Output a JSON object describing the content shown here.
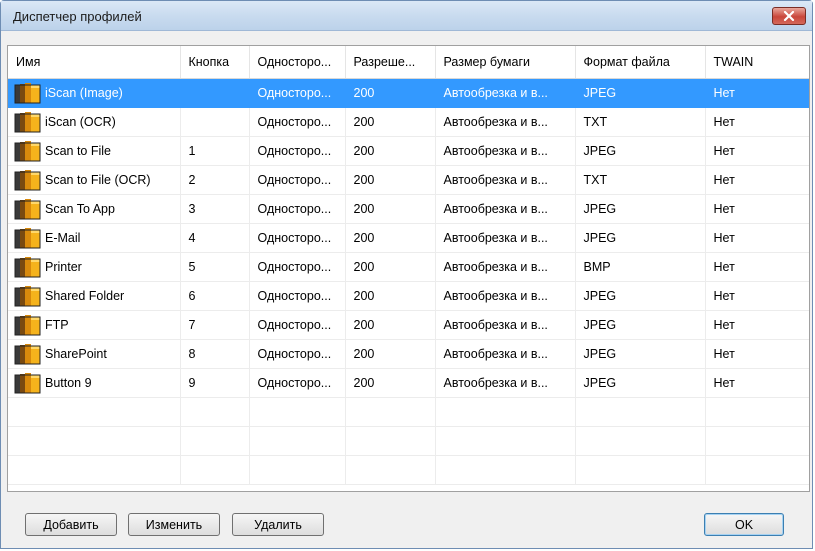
{
  "window": {
    "title": "Диспетчер профилей"
  },
  "columns": [
    "Имя",
    "Кнопка",
    "Односторо...",
    "Разреше...",
    "Размер бумаги",
    "Формат файла",
    "TWAIN"
  ],
  "rows": [
    {
      "name": "iScan (Image)",
      "button": "",
      "sides": "Односторо...",
      "resolution": "200",
      "paper": "Автообрезка и в...",
      "format": "JPEG",
      "twain": "Нет",
      "selected": true
    },
    {
      "name": "iScan (OCR)",
      "button": "",
      "sides": "Односторо...",
      "resolution": "200",
      "paper": "Автообрезка и в...",
      "format": "TXT",
      "twain": "Нет"
    },
    {
      "name": "Scan to File",
      "button": "1",
      "sides": "Односторо...",
      "resolution": "200",
      "paper": "Автообрезка и в...",
      "format": "JPEG",
      "twain": "Нет"
    },
    {
      "name": "Scan to File (OCR)",
      "button": "2",
      "sides": "Односторо...",
      "resolution": "200",
      "paper": "Автообрезка и в...",
      "format": "TXT",
      "twain": "Нет"
    },
    {
      "name": "Scan To App",
      "button": "3",
      "sides": "Односторо...",
      "resolution": "200",
      "paper": "Автообрезка и в...",
      "format": "JPEG",
      "twain": "Нет"
    },
    {
      "name": "E-Mail",
      "button": "4",
      "sides": "Односторо...",
      "resolution": "200",
      "paper": "Автообрезка и в...",
      "format": "JPEG",
      "twain": "Нет"
    },
    {
      "name": "Printer",
      "button": "5",
      "sides": "Односторо...",
      "resolution": "200",
      "paper": "Автообрезка и в...",
      "format": "BMP",
      "twain": "Нет"
    },
    {
      "name": "Shared Folder",
      "button": "6",
      "sides": "Односторо...",
      "resolution": "200",
      "paper": "Автообрезка и в...",
      "format": "JPEG",
      "twain": "Нет"
    },
    {
      "name": "FTP",
      "button": "7",
      "sides": "Односторо...",
      "resolution": "200",
      "paper": "Автообрезка и в...",
      "format": "JPEG",
      "twain": "Нет"
    },
    {
      "name": "SharePoint",
      "button": "8",
      "sides": "Односторо...",
      "resolution": "200",
      "paper": "Автообрезка и в...",
      "format": "JPEG",
      "twain": "Нет"
    },
    {
      "name": "Button 9",
      "button": "9",
      "sides": "Односторо...",
      "resolution": "200",
      "paper": "Автообрезка и в...",
      "format": "JPEG",
      "twain": "Нет"
    }
  ],
  "buttons": {
    "add": "Добавить",
    "edit": "Изменить",
    "delete": "Удалить",
    "ok": "OK"
  },
  "icons": {
    "profile_icon": "profile-pages-icon",
    "close_icon": "close-icon"
  },
  "colors": {
    "selection": "#3399ff",
    "titlebar": "#c9dbef",
    "close": "#c9463a"
  }
}
